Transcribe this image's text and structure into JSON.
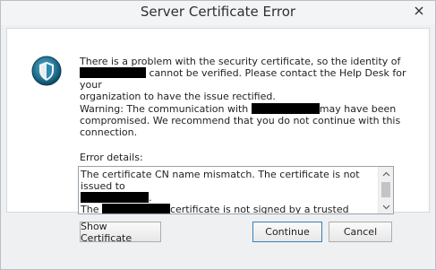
{
  "dialog": {
    "title": "Server Certificate Error"
  },
  "message": {
    "line1": "There is a problem with the security certificate, so the identity of",
    "line2_suffix": " cannot be verified. Please contact the Help Desk for your",
    "line3": "organization to have the issue rectified."
  },
  "warning": {
    "prefix": "Warning: The communication with ",
    "suffix": "may have been",
    "line2": "compromised. We recommend that you do not continue with this",
    "line3": "connection."
  },
  "details": {
    "label": "Error details:",
    "line1": "The certificate CN name mismatch. The certificate is not issued to",
    "line2_suffix": ".",
    "line3_prefix": "The ",
    "line3_suffix": "certificate is not signed by a trusted certificate"
  },
  "buttons": {
    "show_certificate": "Show Certificate",
    "continue": "Continue",
    "cancel": "Cancel"
  },
  "icons": {
    "shield": "shield-icon",
    "close": "close-icon"
  }
}
